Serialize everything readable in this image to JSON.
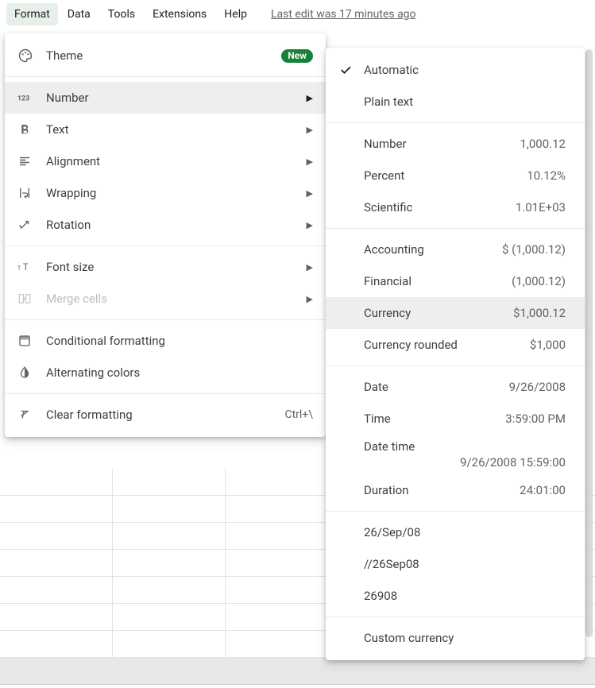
{
  "menubar": {
    "items": [
      "Format",
      "Data",
      "Tools",
      "Extensions",
      "Help"
    ],
    "active_index": 0,
    "last_edit": "Last edit was 17 minutes ago"
  },
  "format_menu": {
    "theme": {
      "label": "Theme",
      "badge": "New"
    },
    "number": {
      "label": "Number"
    },
    "text": {
      "label": "Text"
    },
    "alignment": {
      "label": "Alignment"
    },
    "wrapping": {
      "label": "Wrapping"
    },
    "rotation": {
      "label": "Rotation"
    },
    "font_size": {
      "label": "Font size"
    },
    "merge_cells": {
      "label": "Merge cells"
    },
    "conditional": {
      "label": "Conditional formatting"
    },
    "alternating": {
      "label": "Alternating colors"
    },
    "clear": {
      "label": "Clear formatting",
      "shortcut": "Ctrl+\\"
    }
  },
  "number_submenu": {
    "automatic": {
      "label": "Automatic"
    },
    "plain_text": {
      "label": "Plain text"
    },
    "number": {
      "label": "Number",
      "example": "1,000.12"
    },
    "percent": {
      "label": "Percent",
      "example": "10.12%"
    },
    "scientific": {
      "label": "Scientific",
      "example": "1.01E+03"
    },
    "accounting": {
      "label": "Accounting",
      "example": "$ (1,000.12)"
    },
    "financial": {
      "label": "Financial",
      "example": "(1,000.12)"
    },
    "currency": {
      "label": "Currency",
      "example": "$1,000.12"
    },
    "currency_rounded": {
      "label": "Currency rounded",
      "example": "$1,000"
    },
    "date": {
      "label": "Date",
      "example": "9/26/2008"
    },
    "time": {
      "label": "Time",
      "example": "3:59:00 PM"
    },
    "date_time": {
      "label": "Date time",
      "example": "9/26/2008 15:59:00"
    },
    "duration": {
      "label": "Duration",
      "example": "24:01:00"
    },
    "custom1": {
      "label": "26/Sep/08"
    },
    "custom2": {
      "label": "//26Sep08"
    },
    "custom3": {
      "label": "26908"
    },
    "custom_currency": {
      "label": "Custom currency"
    }
  }
}
